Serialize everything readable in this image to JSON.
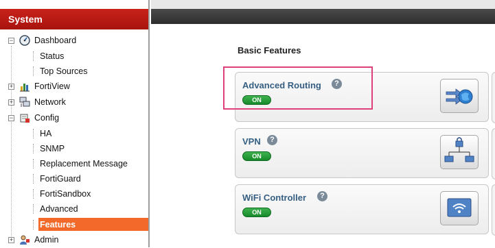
{
  "sidebar": {
    "title": "System",
    "items": [
      {
        "label": "Dashboard",
        "type": "group",
        "expanded": true,
        "icon": "dashboard-icon"
      },
      {
        "label": "Status",
        "type": "leaf"
      },
      {
        "label": "Top Sources",
        "type": "leaf"
      },
      {
        "label": "FortiView",
        "type": "group",
        "expanded": false,
        "icon": "fortiview-icon"
      },
      {
        "label": "Network",
        "type": "group",
        "expanded": false,
        "icon": "network-icon"
      },
      {
        "label": "Config",
        "type": "group",
        "expanded": true,
        "icon": "config-icon"
      },
      {
        "label": "HA",
        "type": "leaf"
      },
      {
        "label": "SNMP",
        "type": "leaf"
      },
      {
        "label": "Replacement Message",
        "type": "leaf"
      },
      {
        "label": "FortiGuard",
        "type": "leaf"
      },
      {
        "label": "FortiSandbox",
        "type": "leaf"
      },
      {
        "label": "Advanced",
        "type": "leaf"
      },
      {
        "label": "Features",
        "type": "leaf",
        "selected": true
      },
      {
        "label": "Admin",
        "type": "group",
        "expanded": false,
        "icon": "admin-icon"
      }
    ]
  },
  "main": {
    "section_title": "Basic Features",
    "features": [
      {
        "name": "Advanced Routing",
        "help": "?",
        "toggle": "ON",
        "icon": "routing-icon"
      },
      {
        "name": "VPN",
        "help": "?",
        "toggle": "ON",
        "icon": "vpn-icon"
      },
      {
        "name": "WiFi Controller",
        "help": "?",
        "toggle": "ON",
        "icon": "wifi-icon"
      }
    ]
  },
  "colors": {
    "header_red": "#b51a13",
    "selected_orange": "#f2692a",
    "feature_blue": "#355e82",
    "toggle_green": "#1f9a34",
    "highlight_pink": "#e0407a"
  }
}
